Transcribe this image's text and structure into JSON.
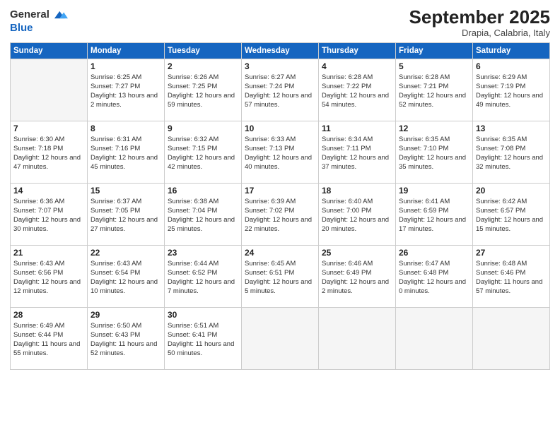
{
  "header": {
    "logo_line1": "General",
    "logo_line2": "Blue",
    "month_year": "September 2025",
    "location": "Drapia, Calabria, Italy"
  },
  "weekdays": [
    "Sunday",
    "Monday",
    "Tuesday",
    "Wednesday",
    "Thursday",
    "Friday",
    "Saturday"
  ],
  "weeks": [
    [
      {
        "day": "",
        "sunrise": "",
        "sunset": "",
        "daylight": ""
      },
      {
        "day": "1",
        "sunrise": "Sunrise: 6:25 AM",
        "sunset": "Sunset: 7:27 PM",
        "daylight": "Daylight: 13 hours and 2 minutes."
      },
      {
        "day": "2",
        "sunrise": "Sunrise: 6:26 AM",
        "sunset": "Sunset: 7:25 PM",
        "daylight": "Daylight: 12 hours and 59 minutes."
      },
      {
        "day": "3",
        "sunrise": "Sunrise: 6:27 AM",
        "sunset": "Sunset: 7:24 PM",
        "daylight": "Daylight: 12 hours and 57 minutes."
      },
      {
        "day": "4",
        "sunrise": "Sunrise: 6:28 AM",
        "sunset": "Sunset: 7:22 PM",
        "daylight": "Daylight: 12 hours and 54 minutes."
      },
      {
        "day": "5",
        "sunrise": "Sunrise: 6:28 AM",
        "sunset": "Sunset: 7:21 PM",
        "daylight": "Daylight: 12 hours and 52 minutes."
      },
      {
        "day": "6",
        "sunrise": "Sunrise: 6:29 AM",
        "sunset": "Sunset: 7:19 PM",
        "daylight": "Daylight: 12 hours and 49 minutes."
      }
    ],
    [
      {
        "day": "7",
        "sunrise": "Sunrise: 6:30 AM",
        "sunset": "Sunset: 7:18 PM",
        "daylight": "Daylight: 12 hours and 47 minutes."
      },
      {
        "day": "8",
        "sunrise": "Sunrise: 6:31 AM",
        "sunset": "Sunset: 7:16 PM",
        "daylight": "Daylight: 12 hours and 45 minutes."
      },
      {
        "day": "9",
        "sunrise": "Sunrise: 6:32 AM",
        "sunset": "Sunset: 7:15 PM",
        "daylight": "Daylight: 12 hours and 42 minutes."
      },
      {
        "day": "10",
        "sunrise": "Sunrise: 6:33 AM",
        "sunset": "Sunset: 7:13 PM",
        "daylight": "Daylight: 12 hours and 40 minutes."
      },
      {
        "day": "11",
        "sunrise": "Sunrise: 6:34 AM",
        "sunset": "Sunset: 7:11 PM",
        "daylight": "Daylight: 12 hours and 37 minutes."
      },
      {
        "day": "12",
        "sunrise": "Sunrise: 6:35 AM",
        "sunset": "Sunset: 7:10 PM",
        "daylight": "Daylight: 12 hours and 35 minutes."
      },
      {
        "day": "13",
        "sunrise": "Sunrise: 6:35 AM",
        "sunset": "Sunset: 7:08 PM",
        "daylight": "Daylight: 12 hours and 32 minutes."
      }
    ],
    [
      {
        "day": "14",
        "sunrise": "Sunrise: 6:36 AM",
        "sunset": "Sunset: 7:07 PM",
        "daylight": "Daylight: 12 hours and 30 minutes."
      },
      {
        "day": "15",
        "sunrise": "Sunrise: 6:37 AM",
        "sunset": "Sunset: 7:05 PM",
        "daylight": "Daylight: 12 hours and 27 minutes."
      },
      {
        "day": "16",
        "sunrise": "Sunrise: 6:38 AM",
        "sunset": "Sunset: 7:04 PM",
        "daylight": "Daylight: 12 hours and 25 minutes."
      },
      {
        "day": "17",
        "sunrise": "Sunrise: 6:39 AM",
        "sunset": "Sunset: 7:02 PM",
        "daylight": "Daylight: 12 hours and 22 minutes."
      },
      {
        "day": "18",
        "sunrise": "Sunrise: 6:40 AM",
        "sunset": "Sunset: 7:00 PM",
        "daylight": "Daylight: 12 hours and 20 minutes."
      },
      {
        "day": "19",
        "sunrise": "Sunrise: 6:41 AM",
        "sunset": "Sunset: 6:59 PM",
        "daylight": "Daylight: 12 hours and 17 minutes."
      },
      {
        "day": "20",
        "sunrise": "Sunrise: 6:42 AM",
        "sunset": "Sunset: 6:57 PM",
        "daylight": "Daylight: 12 hours and 15 minutes."
      }
    ],
    [
      {
        "day": "21",
        "sunrise": "Sunrise: 6:43 AM",
        "sunset": "Sunset: 6:56 PM",
        "daylight": "Daylight: 12 hours and 12 minutes."
      },
      {
        "day": "22",
        "sunrise": "Sunrise: 6:43 AM",
        "sunset": "Sunset: 6:54 PM",
        "daylight": "Daylight: 12 hours and 10 minutes."
      },
      {
        "day": "23",
        "sunrise": "Sunrise: 6:44 AM",
        "sunset": "Sunset: 6:52 PM",
        "daylight": "Daylight: 12 hours and 7 minutes."
      },
      {
        "day": "24",
        "sunrise": "Sunrise: 6:45 AM",
        "sunset": "Sunset: 6:51 PM",
        "daylight": "Daylight: 12 hours and 5 minutes."
      },
      {
        "day": "25",
        "sunrise": "Sunrise: 6:46 AM",
        "sunset": "Sunset: 6:49 PM",
        "daylight": "Daylight: 12 hours and 2 minutes."
      },
      {
        "day": "26",
        "sunrise": "Sunrise: 6:47 AM",
        "sunset": "Sunset: 6:48 PM",
        "daylight": "Daylight: 12 hours and 0 minutes."
      },
      {
        "day": "27",
        "sunrise": "Sunrise: 6:48 AM",
        "sunset": "Sunset: 6:46 PM",
        "daylight": "Daylight: 11 hours and 57 minutes."
      }
    ],
    [
      {
        "day": "28",
        "sunrise": "Sunrise: 6:49 AM",
        "sunset": "Sunset: 6:44 PM",
        "daylight": "Daylight: 11 hours and 55 minutes."
      },
      {
        "day": "29",
        "sunrise": "Sunrise: 6:50 AM",
        "sunset": "Sunset: 6:43 PM",
        "daylight": "Daylight: 11 hours and 52 minutes."
      },
      {
        "day": "30",
        "sunrise": "Sunrise: 6:51 AM",
        "sunset": "Sunset: 6:41 PM",
        "daylight": "Daylight: 11 hours and 50 minutes."
      },
      {
        "day": "",
        "sunrise": "",
        "sunset": "",
        "daylight": ""
      },
      {
        "day": "",
        "sunrise": "",
        "sunset": "",
        "daylight": ""
      },
      {
        "day": "",
        "sunrise": "",
        "sunset": "",
        "daylight": ""
      },
      {
        "day": "",
        "sunrise": "",
        "sunset": "",
        "daylight": ""
      }
    ]
  ]
}
